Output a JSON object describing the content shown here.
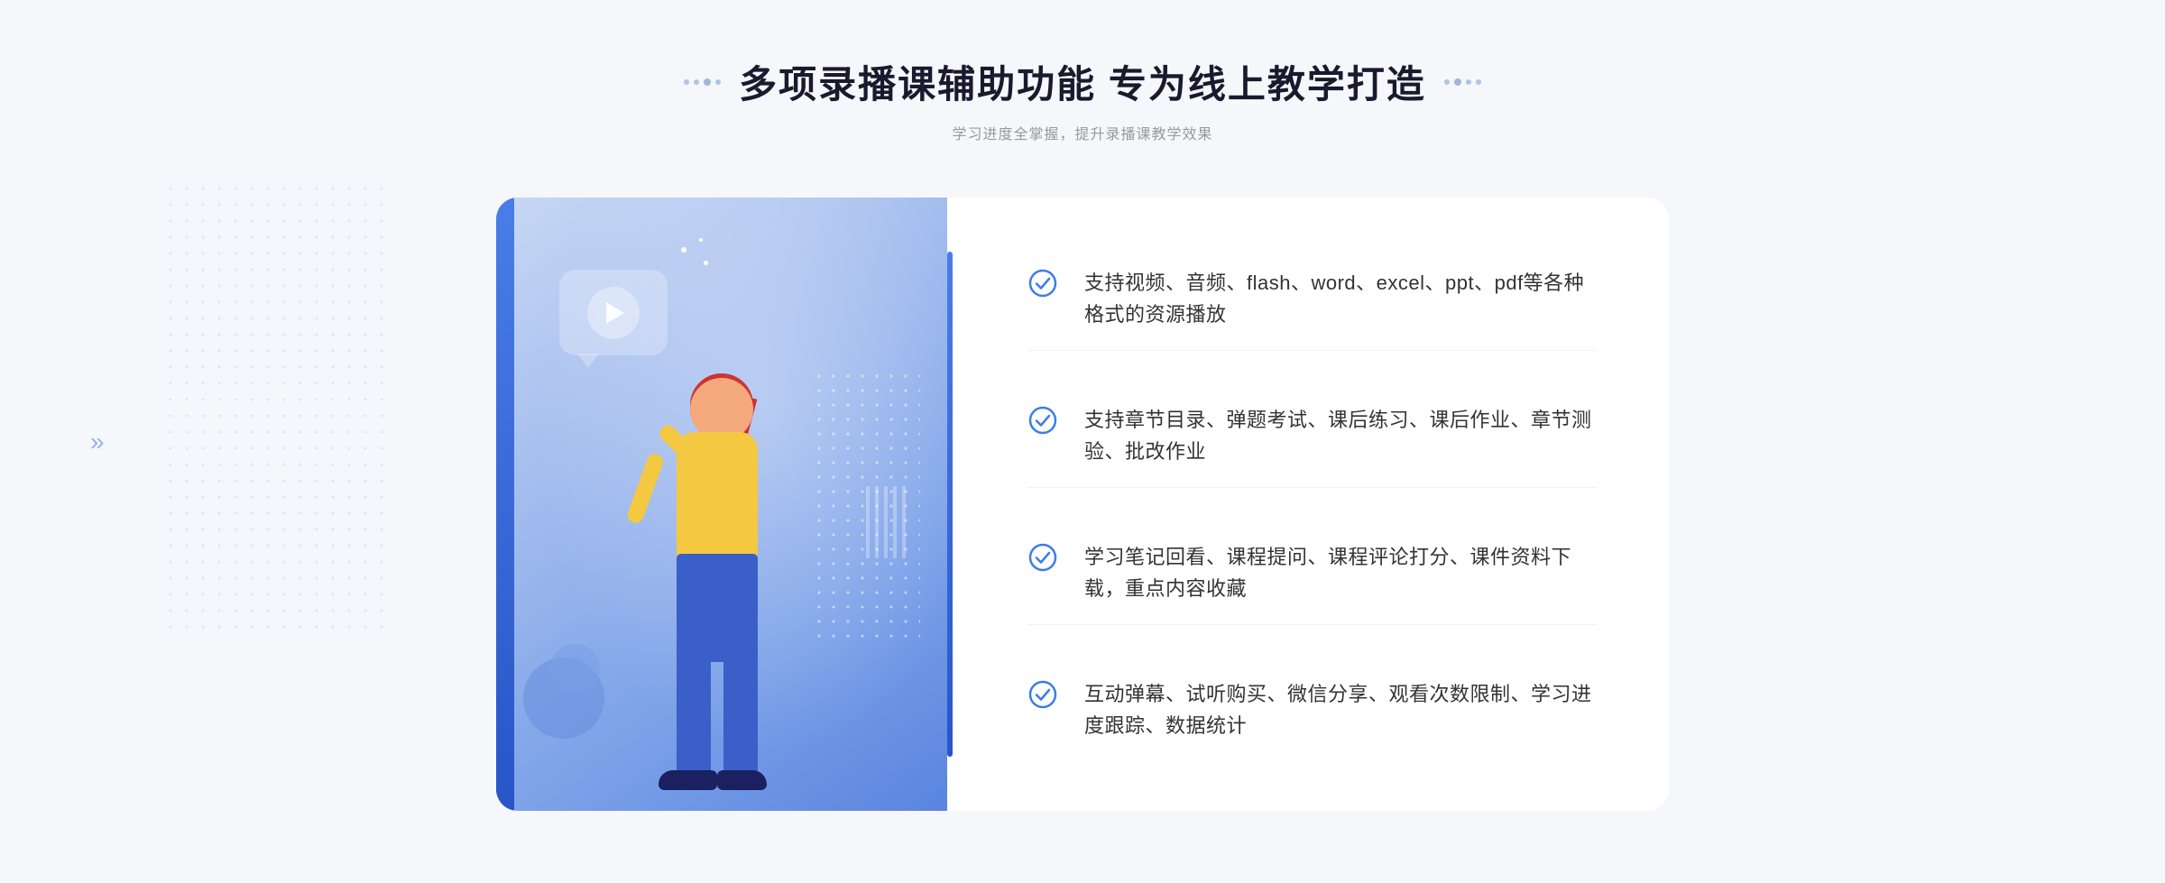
{
  "header": {
    "title": "多项录播课辅助功能 专为线上教学打造",
    "subtitle": "学习进度全掌握，提升录播课教学效果",
    "title_dots_left": "‥",
    "title_dots_right": "‥"
  },
  "features": [
    {
      "id": 1,
      "text": "支持视频、音频、flash、word、excel、ppt、pdf等各种格式的资源播放"
    },
    {
      "id": 2,
      "text": "支持章节目录、弹题考试、课后练习、课后作业、章节测验、批改作业"
    },
    {
      "id": 3,
      "text": "学习笔记回看、课程提问、课程评论打分、课件资料下载，重点内容收藏"
    },
    {
      "id": 4,
      "text": "互动弹幕、试听购买、微信分享、观看次数限制、学习进度跟踪、数据统计"
    }
  ],
  "colors": {
    "accent_blue": "#3d7de8",
    "check_circle": "#3d7de8",
    "title_color": "#1a1a2e",
    "text_color": "#333333",
    "subtitle_color": "#999999"
  }
}
